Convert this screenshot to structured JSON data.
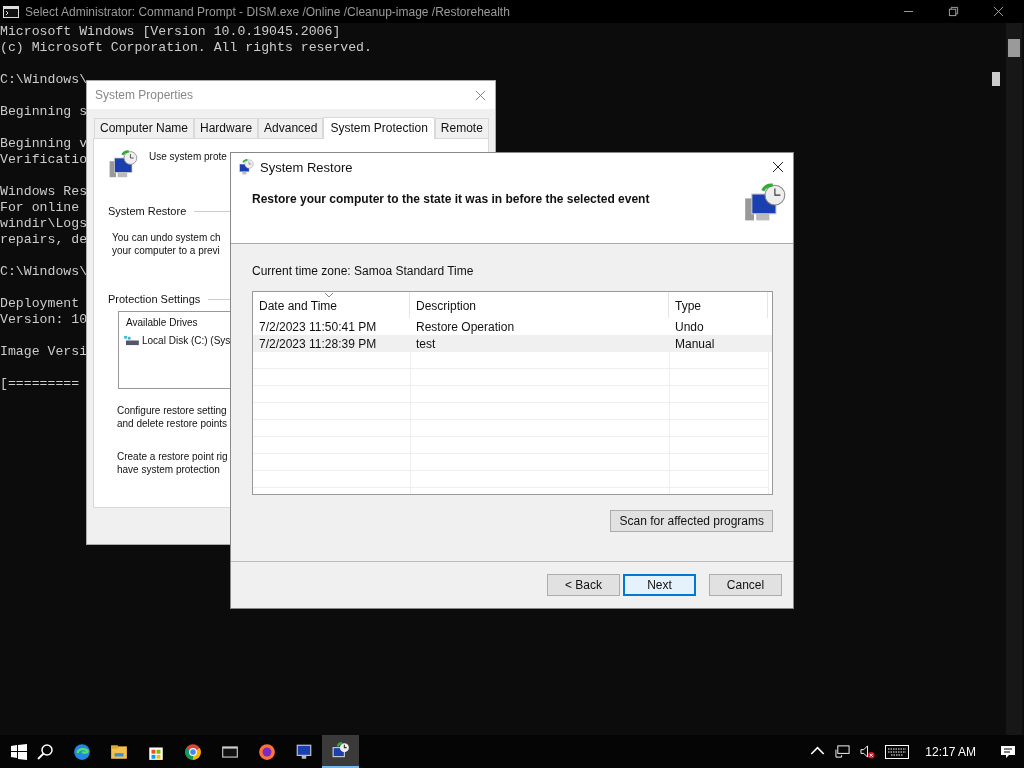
{
  "console": {
    "title": "Select Administrator: Command Prompt - DISM.exe  /Online /Cleanup-image /Restorehealth",
    "blocks": [
      [
        "Microsoft Windows [Version 10.0.19045.2006]",
        "(c) Microsoft Corporation. All rights reserved."
      ],
      [
        "C:\\Windows\\"
      ],
      [
        "Beginning s"
      ],
      [
        "Beginning v",
        "Verificatio"
      ],
      [
        "Windows Res",
        "For online",
        "windir\\Logs",
        "repairs, de"
      ],
      [
        "C:\\Windows\\"
      ],
      [
        "Deployment",
        "Version: 10"
      ],
      [
        "Image Versi"
      ],
      [
        "[========="
      ]
    ]
  },
  "system_properties": {
    "title": "System Properties",
    "tabs": [
      {
        "label": "Computer Name",
        "selected": false
      },
      {
        "label": "Hardware",
        "selected": false
      },
      {
        "label": "Advanced",
        "selected": false
      },
      {
        "label": "System Protection",
        "selected": true
      },
      {
        "label": "Remote",
        "selected": false
      }
    ],
    "intro": "Use system prote",
    "system_restore": {
      "label": "System Restore",
      "lines": [
        "You can undo system ch",
        "your computer to a previ"
      ]
    },
    "protection_settings": {
      "label": "Protection Settings",
      "column": "Available Drives",
      "drives": [
        "Local Disk (C:) (Sys"
      ]
    },
    "configure_lines": [
      "Configure restore setting",
      "and delete restore points"
    ],
    "create_lines": [
      "Create a restore point rig",
      "have system protection"
    ]
  },
  "system_restore": {
    "title": "System Restore",
    "heading": "Restore your computer to the state it was in before the selected event",
    "time_zone": "Current time zone: Samoa Standard Time",
    "columns": [
      {
        "label": "Date and Time",
        "sorted": true
      },
      {
        "label": "Description",
        "sorted": false
      },
      {
        "label": "Type",
        "sorted": false
      }
    ],
    "rows": [
      {
        "cells": [
          "7/2/2023 11:50:41 PM",
          "Restore Operation",
          "Undo"
        ],
        "selected": false
      },
      {
        "cells": [
          "7/2/2023 11:28:39 PM",
          "test",
          "Manual"
        ],
        "selected": true
      }
    ],
    "scan_button": "Scan for affected programs",
    "buttons": [
      {
        "label": "< Back",
        "focused": false
      },
      {
        "label": "Next",
        "focused": true
      },
      {
        "label": "Cancel",
        "focused": false
      }
    ]
  },
  "taskbar": {
    "apps": [
      {
        "kind": "edge",
        "active": false
      },
      {
        "kind": "explorer",
        "active": false
      },
      {
        "kind": "store",
        "active": false
      },
      {
        "kind": "chrome",
        "active": false
      },
      {
        "kind": "console",
        "active": false
      },
      {
        "kind": "firefox",
        "active": false
      },
      {
        "kind": "monitor",
        "active": false
      },
      {
        "kind": "restore",
        "active": true
      }
    ],
    "time": "12:17 AM"
  }
}
